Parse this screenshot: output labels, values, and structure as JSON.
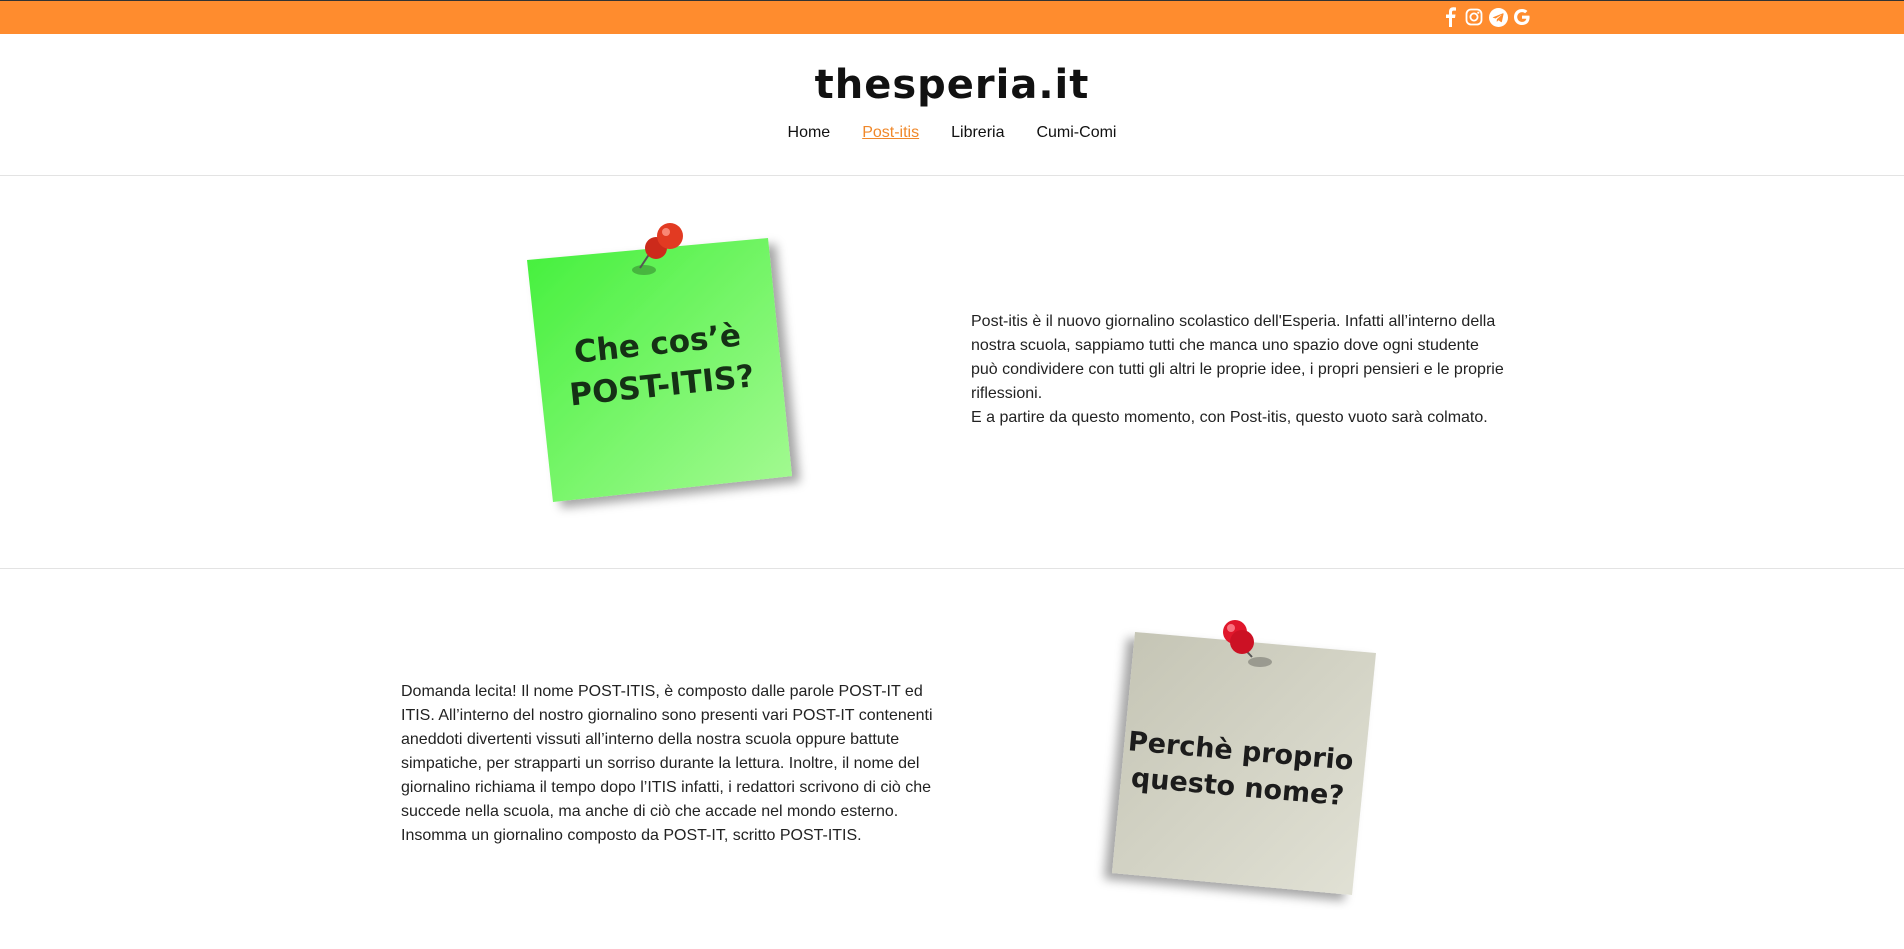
{
  "header": {
    "social_icons": [
      "facebook-icon",
      "instagram-icon",
      "telegram-icon",
      "google-icon"
    ],
    "accent_color": "#ff8c2e",
    "logo_text": "thesperia.it"
  },
  "nav": {
    "items": [
      {
        "label": "Home",
        "active": false
      },
      {
        "label": "Post-itis",
        "active": true
      },
      {
        "label": "Libreria",
        "active": false
      },
      {
        "label": "Cumi-Comi",
        "active": false
      }
    ]
  },
  "section1": {
    "note_text": [
      "Che cos’è",
      "POST-ITIS?"
    ],
    "note_color": "#6ef567",
    "paragraph1": "Post-itis è il nuovo giornalino scolastico dell'Esperia. Infatti all’interno della nostra scuola, sappiamo tutti che manca uno spazio dove ogni studente può condividere con tutti gli altri le proprie idee, i propri pensieri e le proprie riflessioni.",
    "paragraph2": "E a partire da questo momento, con Post-itis, questo vuoto sarà colmato."
  },
  "section2": {
    "note_text": [
      "Perchè proprio",
      "questo nome?"
    ],
    "note_color": "#d3d3c6",
    "paragraph": "Domanda lecita! Il nome POST-ITIS, è composto dalle parole POST-IT ed ITIS. All’interno del nostro giornalino sono presenti vari POST-IT contenenti aneddoti divertenti vissuti all’interno della nostra scuola oppure battute simpatiche, per strapparti un sorriso durante la lettura. Inoltre, il nome del giornalino richiama il tempo dopo l’ITIS infatti, i redattori scrivono di ciò che succede nella scuola, ma anche di ciò che accade nel mondo esterno. Insomma un giornalino composto da POST-IT, scritto POST-ITIS."
  }
}
